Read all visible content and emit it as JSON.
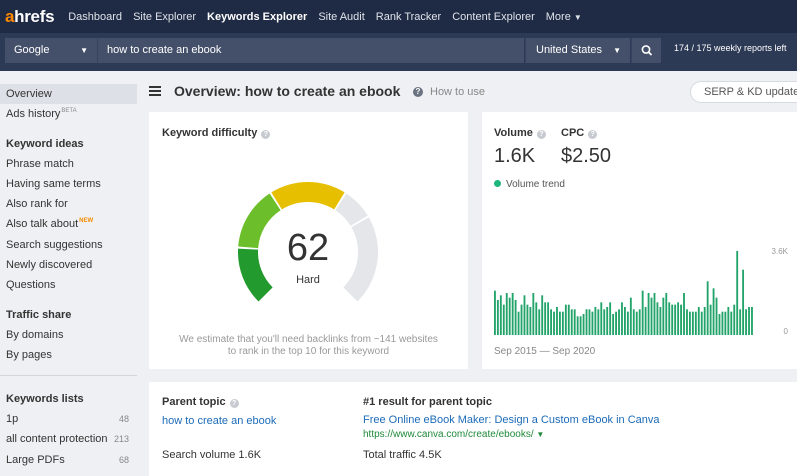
{
  "nav": {
    "logo_a": "a",
    "logo_rest": "hrefs",
    "links": [
      "Dashboard",
      "Site Explorer",
      "Keywords Explorer",
      "Site Audit",
      "Rank Tracker",
      "Content Explorer",
      "More"
    ]
  },
  "search": {
    "engine": "Google",
    "query": "how to create an ebook",
    "country": "United States",
    "reports_left": "174 / 175 weekly reports left"
  },
  "sidebar": {
    "overview": "Overview",
    "ads_history": "Ads history",
    "ads_history_sup": "BETA",
    "keyword_ideas_heading": "Keyword ideas",
    "keyword_ideas": [
      "Phrase match",
      "Having same terms",
      "Also rank for",
      "Also talk about",
      "Search suggestions",
      "Newly discovered",
      "Questions"
    ],
    "new_badge": "NEW",
    "traffic_share_heading": "Traffic share",
    "traffic_share": [
      "By domains",
      "By pages"
    ],
    "keywords_lists_heading": "Keywords lists",
    "lists": [
      {
        "name": "1p",
        "count": "48"
      },
      {
        "name": "all content protection",
        "count": "213"
      },
      {
        "name": "Large PDFs",
        "count": "68"
      }
    ]
  },
  "header": {
    "title": "Overview: how to create an ebook",
    "how_to_use": "How to use",
    "serp_button": "SERP & KD update"
  },
  "kd": {
    "label": "Keyword difficulty",
    "value": "62",
    "score": 62,
    "level": "Hard",
    "note_line1": "We estimate that you'll need backlinks from ~141 websites",
    "note_line2": "to rank in the top 10 for this keyword"
  },
  "volume": {
    "label": "Volume",
    "value": "1.6K",
    "cpc_label": "CPC",
    "cpc_value": "$2.50",
    "trend_label": "Volume trend",
    "range": "Sep 2015 — Sep 2020"
  },
  "chart_data": {
    "type": "bar",
    "series": [
      {
        "name": "Volume trend",
        "values": [
          1.9,
          1.5,
          1.7,
          1.3,
          1.8,
          1.6,
          1.8,
          1.5,
          1.0,
          1.3,
          1.7,
          1.3,
          1.2,
          1.8,
          1.4,
          1.1,
          1.7,
          1.4,
          1.4,
          1.1,
          1.0,
          1.2,
          1.0,
          1.0,
          1.3,
          1.3,
          1.1,
          1.1,
          0.8,
          0.8,
          0.9,
          1.1,
          1.1,
          1.0,
          1.2,
          1.1,
          1.4,
          1.1,
          1.2,
          1.4,
          0.9,
          1.0,
          1.1,
          1.4,
          1.2,
          1.0,
          1.6,
          1.1,
          1.0,
          1.1,
          1.9,
          1.2,
          1.8,
          1.6,
          1.8,
          1.4,
          1.2,
          1.6,
          1.8,
          1.4,
          1.3,
          1.3,
          1.4,
          1.3,
          1.8,
          1.1,
          1.0,
          1.0,
          1.0,
          1.2,
          1.0,
          1.2,
          2.3,
          1.3,
          2.0,
          1.6,
          0.9,
          1.0,
          1.0,
          1.2,
          1.0,
          1.3,
          3.6,
          1.1,
          2.8,
          1.1,
          1.2,
          1.2
        ]
      }
    ],
    "x_range_label": "Sep 2015 — Sep 2020",
    "ylim": [
      0,
      3.6
    ],
    "ytick_labels": [
      "3.6K",
      "0"
    ],
    "color": "#22a36a"
  },
  "parent": {
    "label": "Parent topic",
    "link": "how to create an ebook",
    "search_volume": "Search volume 1.6K",
    "r1_label": "#1 result for parent topic",
    "r1_title": "Free Online eBook Maker: Design a Custom eBook in Canva",
    "r1_url": "https://www.canva.com/create/ebooks/",
    "r1_traffic": "Total traffic 4.5K"
  },
  "colors": {
    "nav_bg": "#1f2a44",
    "brand_orange": "#ff8800",
    "link_blue": "#1c6bb8",
    "url_green": "#1f8a3a"
  }
}
